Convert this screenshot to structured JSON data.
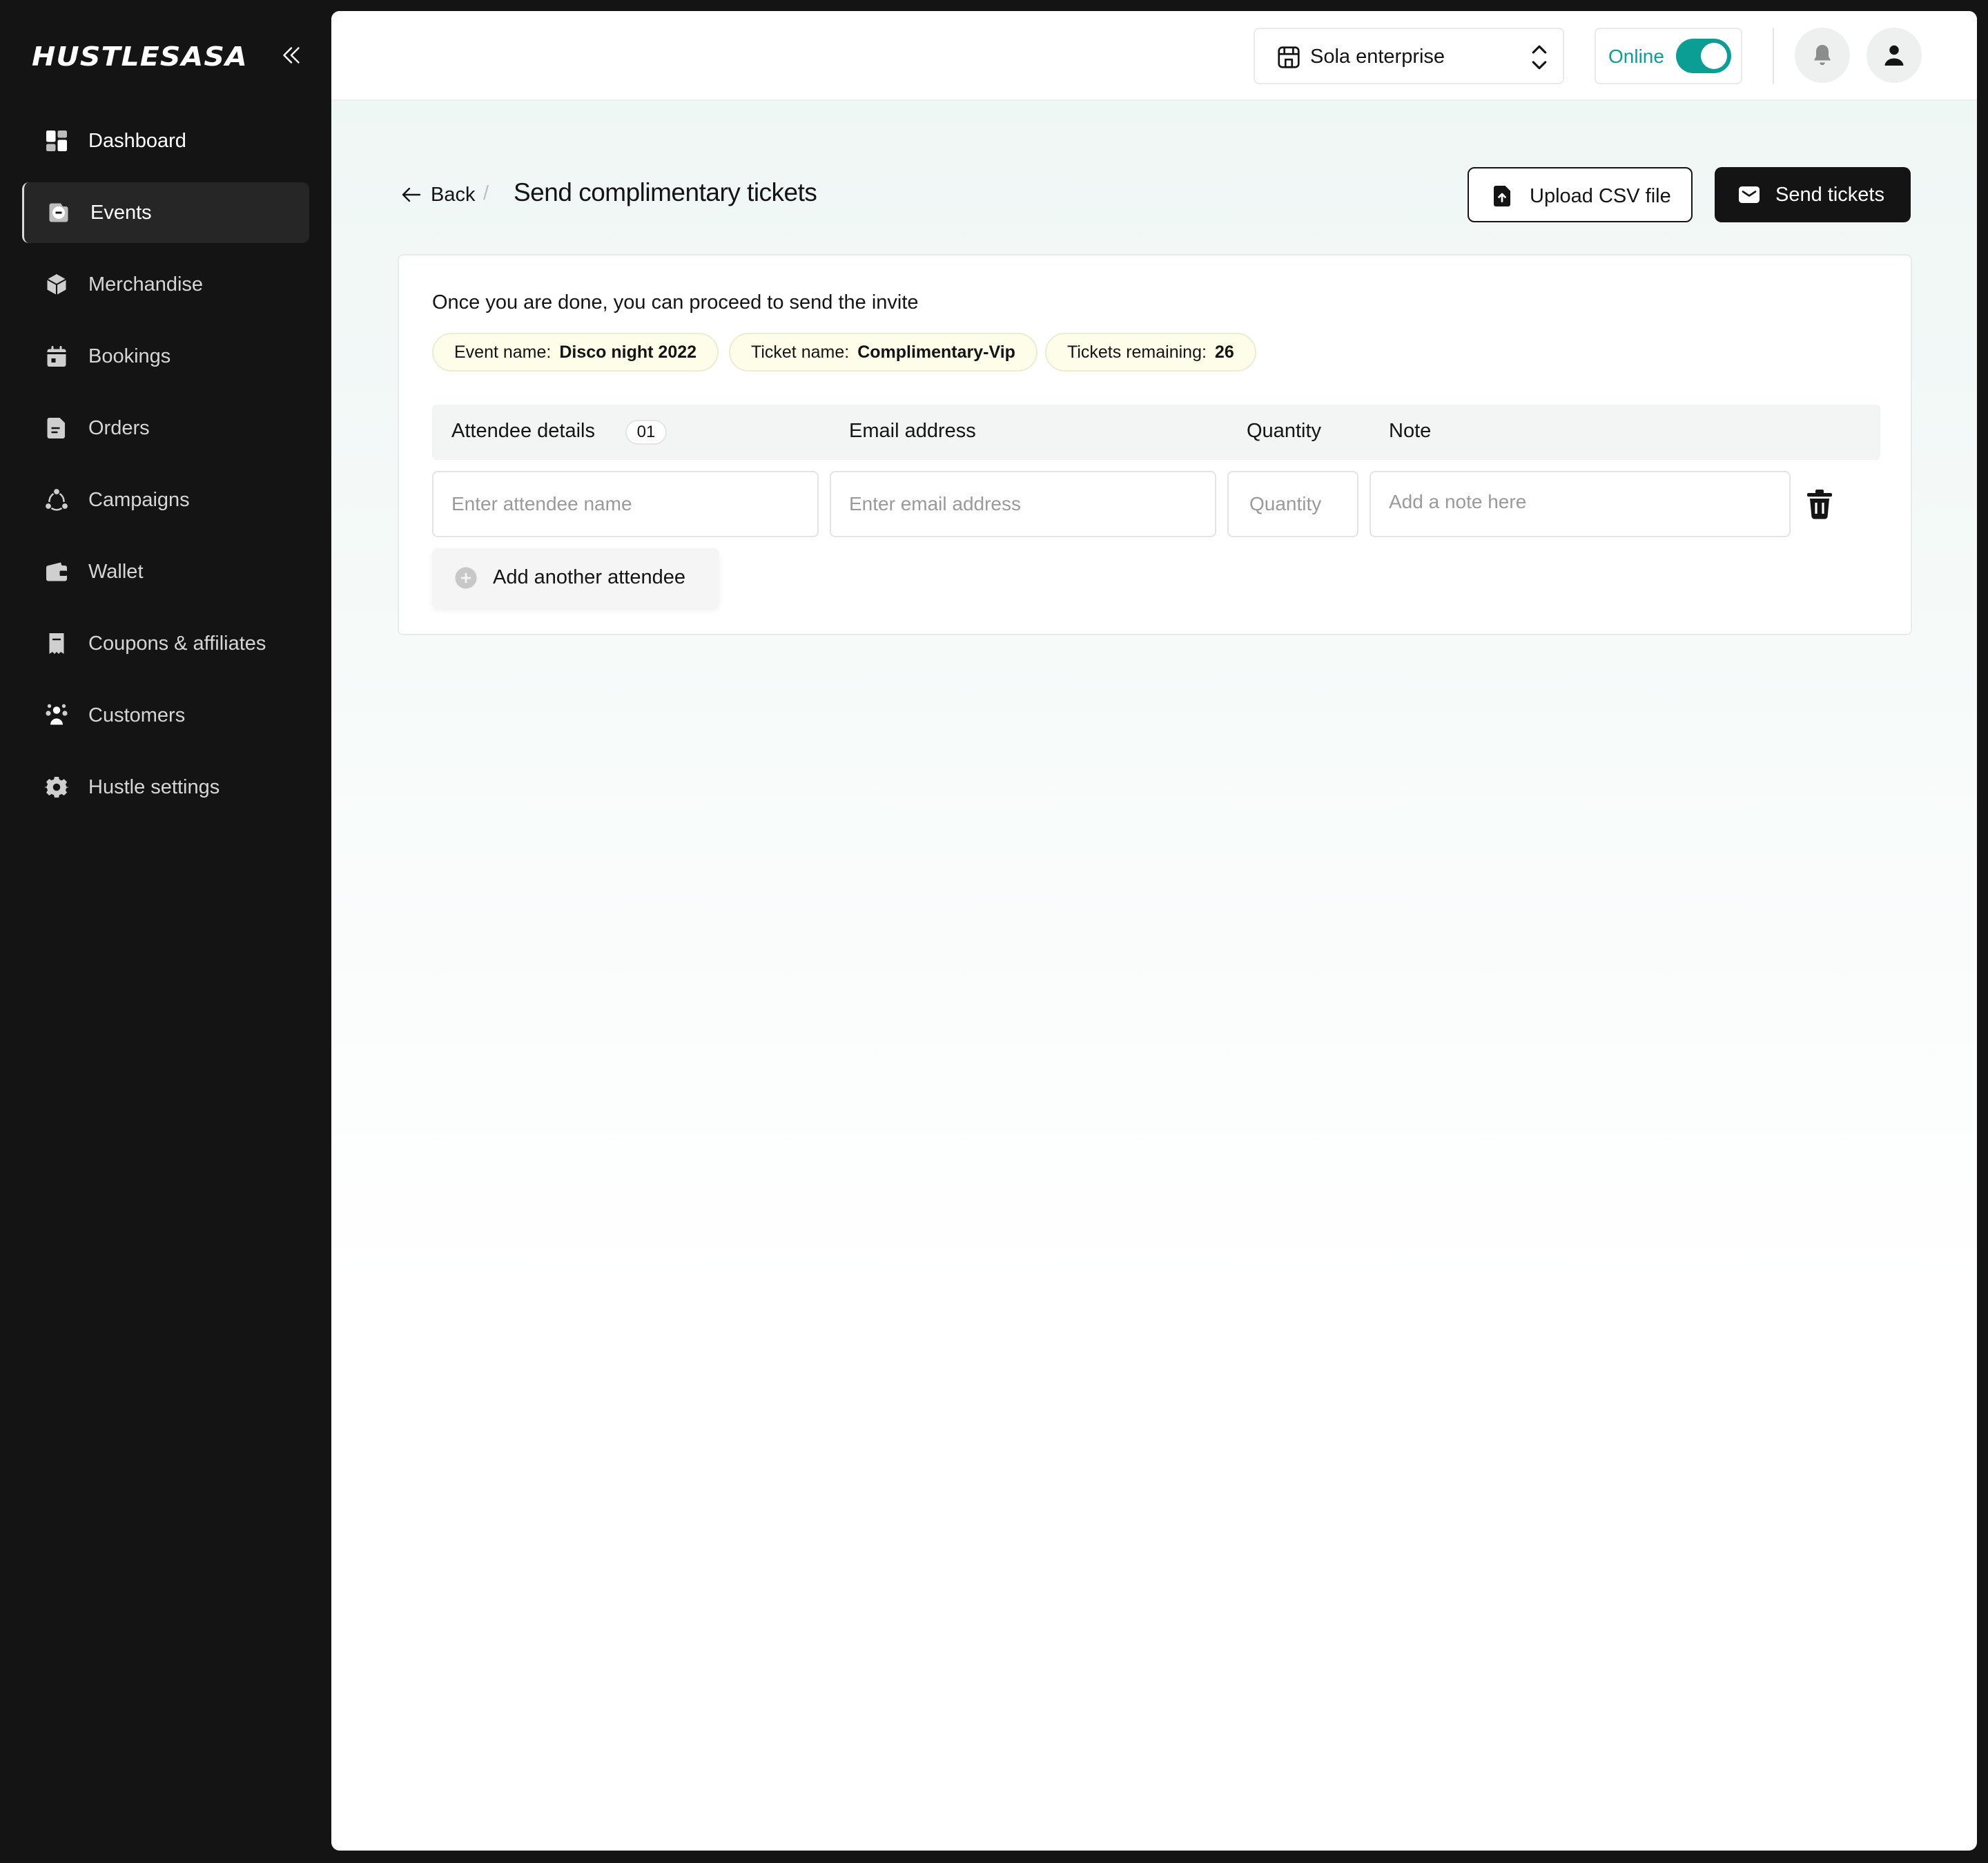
{
  "sidebar": {
    "logo": "HUSTLESASA",
    "items": [
      {
        "label": "Dashboard",
        "icon": "grid-icon"
      },
      {
        "label": "Events",
        "icon": "events-icon"
      },
      {
        "label": "Merchandise",
        "icon": "box-icon"
      },
      {
        "label": "Bookings",
        "icon": "calendar-icon"
      },
      {
        "label": "Orders",
        "icon": "document-icon"
      },
      {
        "label": "Campaigns",
        "icon": "campaigns-icon"
      },
      {
        "label": "Wallet",
        "icon": "wallet-icon"
      },
      {
        "label": "Coupons & affiliates",
        "icon": "coupon-icon"
      },
      {
        "label": "Customers",
        "icon": "customers-icon"
      },
      {
        "label": "Hustle settings",
        "icon": "settings-icon"
      }
    ],
    "active": "Events"
  },
  "topbar": {
    "business": "Sola enterprise",
    "status_label": "Online",
    "status_on": true
  },
  "header": {
    "back_label": "Back",
    "separator": "/",
    "title": "Send complimentary tickets",
    "upload_label": "Upload CSV file",
    "send_label": "Send tickets"
  },
  "card": {
    "intro": "Once you are done, you can proceed to send the invite",
    "chips": [
      {
        "key": "Event name:",
        "value": "Disco night 2022"
      },
      {
        "key": "Ticket name:",
        "value": "Complimentary-Vip"
      },
      {
        "key": "Tickets remaining:",
        "value": "26"
      }
    ],
    "columns": {
      "attendee": "Attendee details",
      "attendee_count": "01",
      "email": "Email address",
      "quantity": "Quantity",
      "note": "Note"
    },
    "row": {
      "name_placeholder": "Enter attendee name",
      "email_placeholder": "Enter email address",
      "quantity_placeholder": "Quantity",
      "note_placeholder": "Add a note here"
    },
    "add_label": "Add another attendee"
  },
  "colors": {
    "accent": "#0a9e94",
    "sidebar_bg": "#141414",
    "chip_bg": "#fdfde9"
  }
}
